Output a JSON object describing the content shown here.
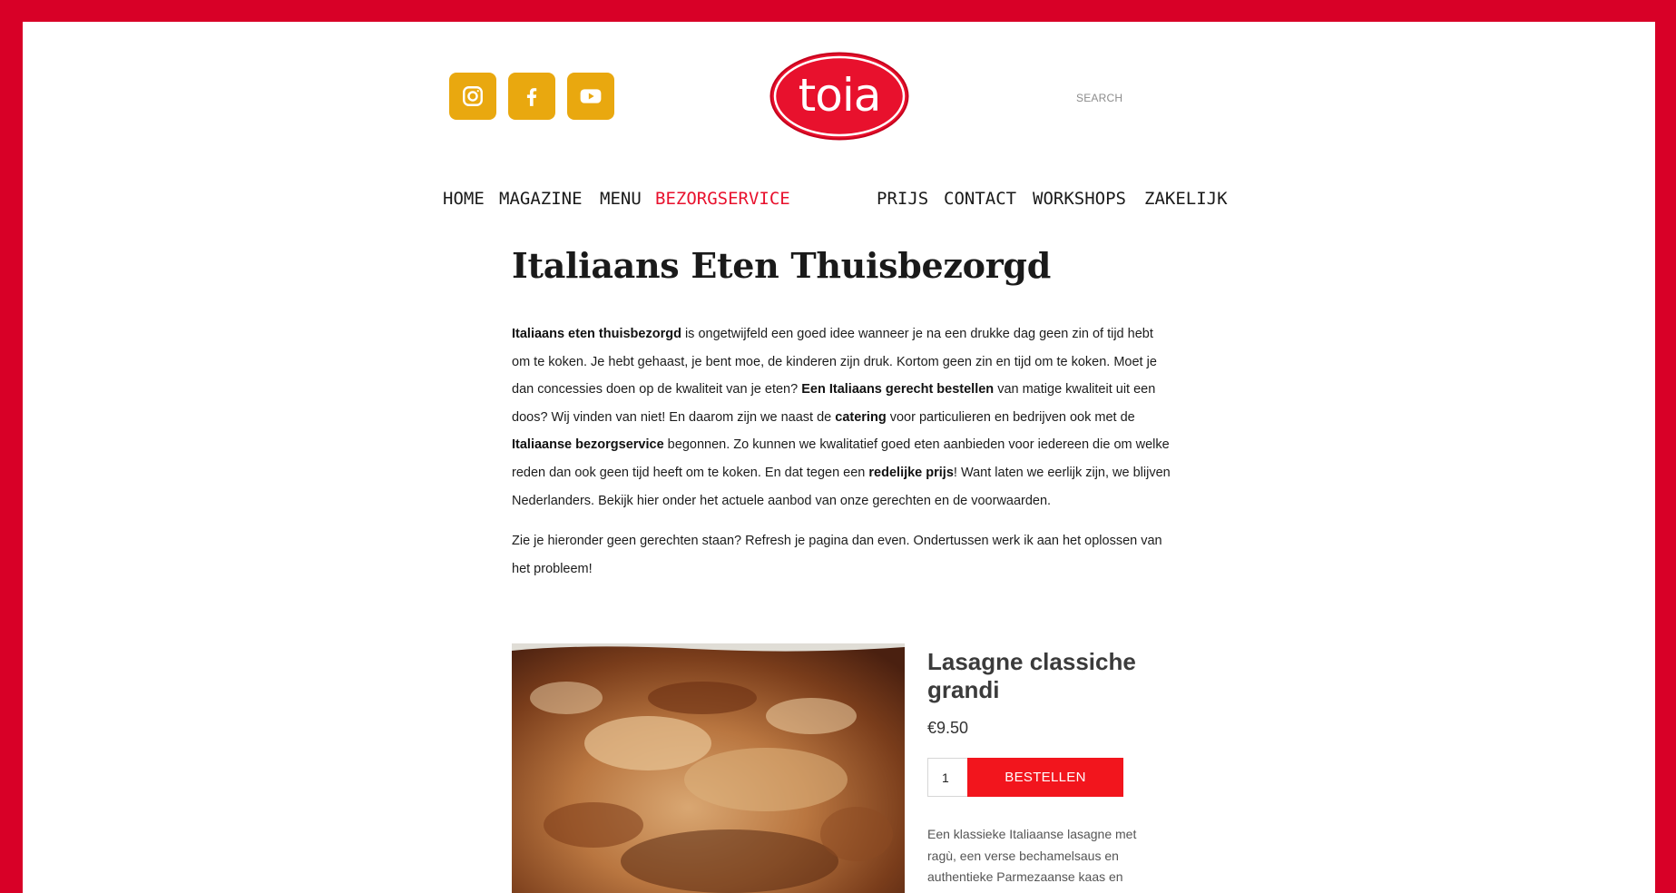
{
  "header": {
    "social": [
      {
        "name": "instagram-icon"
      },
      {
        "name": "facebook-icon"
      },
      {
        "name": "youtube-icon"
      }
    ],
    "logo_text": "toia",
    "search_placeholder": "SEARCH"
  },
  "nav": {
    "items": [
      "HOME",
      "MAGAZINE",
      "MENU",
      "BEZORGSERVICE",
      "PRIJS",
      "CONTACT",
      "WORKSHOPS",
      "ZAKELIJK"
    ],
    "active": "BEZORGSERVICE"
  },
  "page": {
    "title": "Italiaans Eten Thuisbezorgd",
    "intro": [
      {
        "text": "Italiaans eten thuisbezorgd",
        "bold": true
      },
      {
        "text": " is ongetwijfeld een goed idee wanneer je na een drukke dag geen zin of tijd hebt om te koken. Je hebt gehaast, je bent moe, de kinderen zijn druk. Kortom geen zin en tijd om te koken. Moet je dan concessies doen op de kwaliteit van je eten? ",
        "bold": false
      },
      {
        "text": "Een Italiaans gerecht bestellen",
        "bold": true
      },
      {
        "text": " van matige kwaliteit uit een doos? Wij vinden van niet! En daarom zijn we naast de ",
        "bold": false
      },
      {
        "text": "catering",
        "bold": true
      },
      {
        "text": " voor particulieren en bedrijven ook met de ",
        "bold": false
      },
      {
        "text": "Italiaanse bezorgservice",
        "bold": true
      },
      {
        "text": " begonnen. Zo kunnen we kwalitatief goed eten aanbieden voor iedereen die om welke reden dan ook geen tijd heeft om te koken. En dat tegen een ",
        "bold": false
      },
      {
        "text": "redelijke prijs",
        "bold": true
      },
      {
        "text": "! Want laten we eerlijk zijn, we blijven Nederlanders. Bekijk hier onder het actuele aanbod van onze gerechten en de voorwaarden.",
        "bold": false
      }
    ],
    "note": "Zie je hieronder geen gerechten staan? Refresh je pagina dan even. Ondertussen werk ik aan het oplossen van het probleem!"
  },
  "product": {
    "title": "Lasagne classiche grandi",
    "price": "€9.50",
    "quantity": "1",
    "order_label": "BESTELLEN",
    "description": "Een klassieke Italiaanse lasagne met ragù, een verse bechamelsaus en authentieke Parmezaanse kaas en"
  },
  "colors": {
    "frame": "#d80027",
    "social_bg": "#e9a80f",
    "accent": "#e8112d",
    "order_button": "#f2151d"
  }
}
